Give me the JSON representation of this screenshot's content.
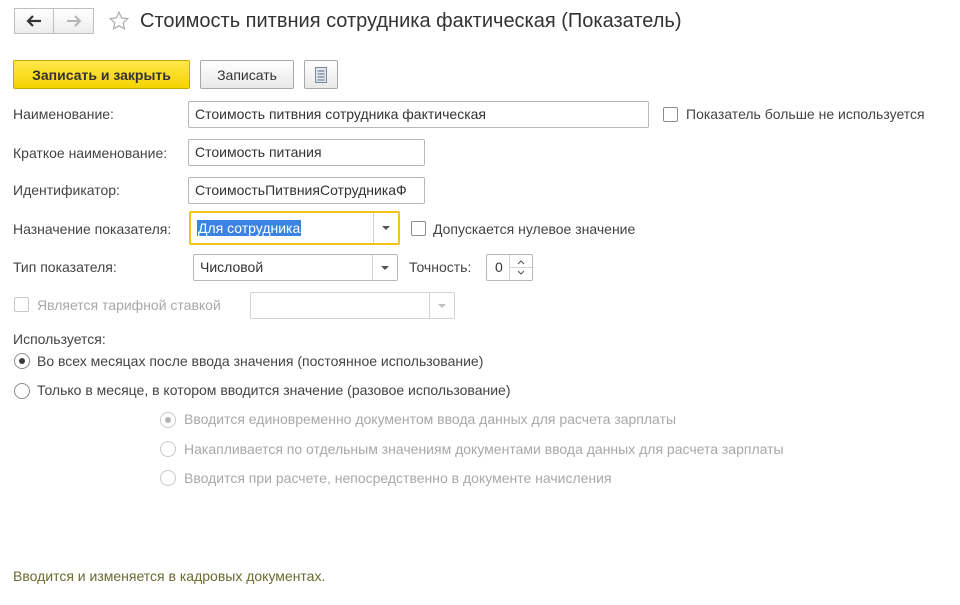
{
  "window": {
    "title": "Стоимость питвния сотрудника фактическая (Показатель)"
  },
  "toolbar": {
    "save_close_label": "Записать и закрыть",
    "save_label": "Записать"
  },
  "form": {
    "name_label": "Наименование:",
    "name_value": "Стоимость питвния сотрудника фактическая",
    "not_used_label": "Показатель больше не используется",
    "short_name_label": "Краткое наименование:",
    "short_name_value": "Стоимость питания",
    "identifier_label": "Идентификатор:",
    "identifier_value": "СтоимостьПитвнияСотрудникаФ",
    "purpose_label": "Назначение показателя:",
    "purpose_value": "Для сотрудника",
    "zero_allowed_label": "Допускается нулевое значение",
    "type_label": "Тип показателя:",
    "type_value": "Числовой",
    "precision_label": "Точность:",
    "precision_value": "0",
    "tariff_label": "Является тарифной ставкой",
    "tariff_value": ""
  },
  "usage": {
    "heading": "Используется:",
    "options": [
      {
        "label": "Во всех месяцах после ввода значения (постоянное использование)",
        "selected": true
      },
      {
        "label": "Только в месяце, в котором вводится значение (разовое использование)",
        "selected": false
      }
    ],
    "sub_options": [
      {
        "label": "Вводится единовременно документом ввода данных для расчета зарплаты",
        "selected": true
      },
      {
        "label": "Накапливается по отдельным значениям документами ввода данных для расчета зарплаты",
        "selected": false
      },
      {
        "label": "Вводится при расчете, непосредственно в документе начисления",
        "selected": false
      }
    ]
  },
  "footer": {
    "note": "Вводится и изменяется в кадровых документах."
  },
  "colors": {
    "accent": "#f5d300",
    "focus_border": "#f0c419",
    "selection": "#3b83e3",
    "footer_text": "#6b6b2f"
  },
  "icons": {
    "back": "arrow-left-icon",
    "forward": "arrow-right-icon",
    "favorite": "star-icon",
    "more": "document-icon"
  }
}
